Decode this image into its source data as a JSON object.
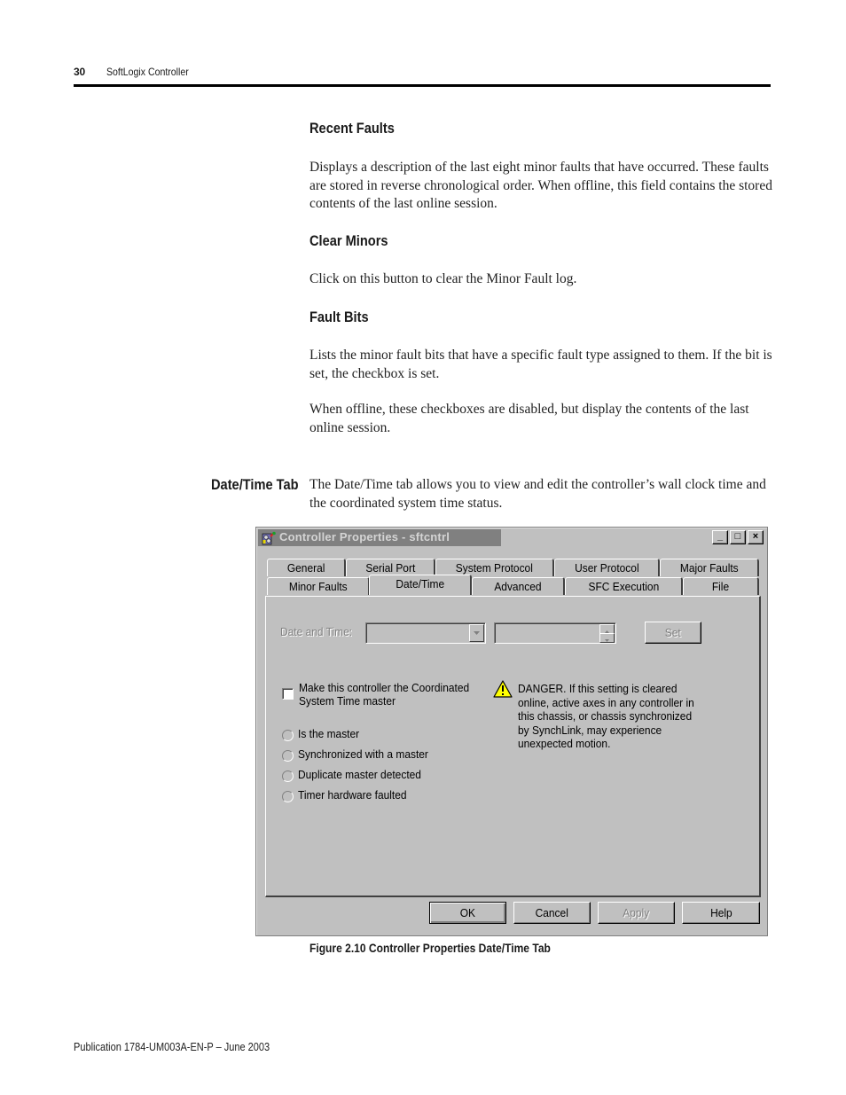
{
  "header": {
    "page_number": "30",
    "running_title": "SoftLogix Controller"
  },
  "sections": [
    {
      "heading": "Recent Faults",
      "paragraphs": [
        "Displays a description of the last eight minor faults that have occurred. These faults are stored in reverse chronological order. When offline, this field contains the stored contents of the last online session."
      ]
    },
    {
      "heading": "Clear Minors",
      "paragraphs": [
        "Click on this button to clear the Minor Fault log."
      ]
    },
    {
      "heading": "Fault Bits",
      "paragraphs": [
        "Lists the minor fault bits that have a specific fault type assigned to them. If the bit is set, the checkbox is set.",
        "When offline, these checkboxes are disabled, but display the contents of the last online session."
      ]
    }
  ],
  "datetime_section": {
    "side_heading": "Date/Time Tab",
    "paragraph": "The Date/Time tab allows you to view and edit the controller’s wall clock time and the coordinated system time status."
  },
  "dialog": {
    "title": "Controller Properties - sftcntrl",
    "caption_buttons": {
      "minimize": "_",
      "maximize": "□",
      "close": "×"
    },
    "tabs_row1": [
      "General",
      "Serial Port",
      "System Protocol",
      "User Protocol",
      "Major Faults"
    ],
    "tabs_row2": [
      "Minor Faults",
      "Date/Time",
      "Advanced",
      "SFC Execution",
      "File"
    ],
    "active_tab": "Date/Time",
    "date_time_label": "Date and Time:",
    "date_value": "",
    "time_value": "",
    "set_button": "Set",
    "cst_master_checkbox": {
      "label_line1": "Make this controller the Coordinated",
      "label_line2": "System Time master",
      "checked": false
    },
    "status_radios": [
      "Is the master",
      "Synchronized with a master",
      "Duplicate master detected",
      "Timer hardware faulted"
    ],
    "danger_text": "DANGER. If this setting is cleared online, active axes in any controller in this chassis, or chassis synchronized by SynchLink, may experience unexpected motion.",
    "buttons": {
      "ok": "OK",
      "cancel": "Cancel",
      "apply": "Apply",
      "help": "Help"
    }
  },
  "figure_caption": "Figure 2.10 Controller Properties Date/Time Tab",
  "footer": "Publication 1784-UM003A-EN-P – June 2003"
}
